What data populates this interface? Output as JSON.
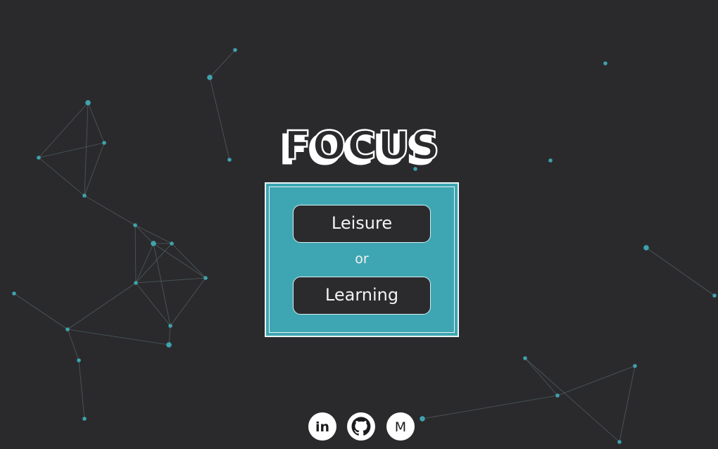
{
  "logo": {
    "text": "FOCUS"
  },
  "choices": {
    "leisure_label": "Leisure",
    "or_label": "or",
    "learning_label": "Learning"
  },
  "social": {
    "linkedin_icon": "linkedin-icon",
    "github_icon": "github-icon",
    "gmail_icon": "gmail-icon",
    "linkedin_glyph": "in",
    "gmail_glyph": "M"
  },
  "colors": {
    "background": "#2a2a2c",
    "accent": "#3ea6b2",
    "button_fill": "#2b2b2e",
    "node": "#3fa2ad"
  }
}
